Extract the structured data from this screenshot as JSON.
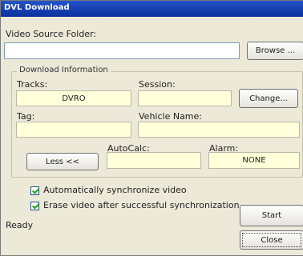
{
  "window": {
    "title": "DVL Download"
  },
  "video_source": {
    "label": "Video Source Folder:",
    "value": "",
    "browse_label": "Browse ..."
  },
  "download_info": {
    "legend": "Download Information",
    "tracks_label": "Tracks:",
    "tracks_value": "DVRO",
    "session_label": "Session:",
    "session_value": "",
    "change_label": "Change...",
    "tag_label": "Tag:",
    "tag_value": "",
    "vehicle_label": "Vehicle Name:",
    "vehicle_value": "",
    "less_label": "Less <<",
    "autocalc_label": "AutoCalc:",
    "autocalc_value": "",
    "alarm_label": "Alarm:",
    "alarm_value": "NONE"
  },
  "options": {
    "auto_sync": {
      "label": "Automatically synchronize video",
      "checked": true
    },
    "erase": {
      "label": "Erase video after successful synchronization",
      "checked": true
    }
  },
  "status": {
    "text": "Ready"
  },
  "buttons": {
    "start": "Start",
    "close": "Close"
  }
}
